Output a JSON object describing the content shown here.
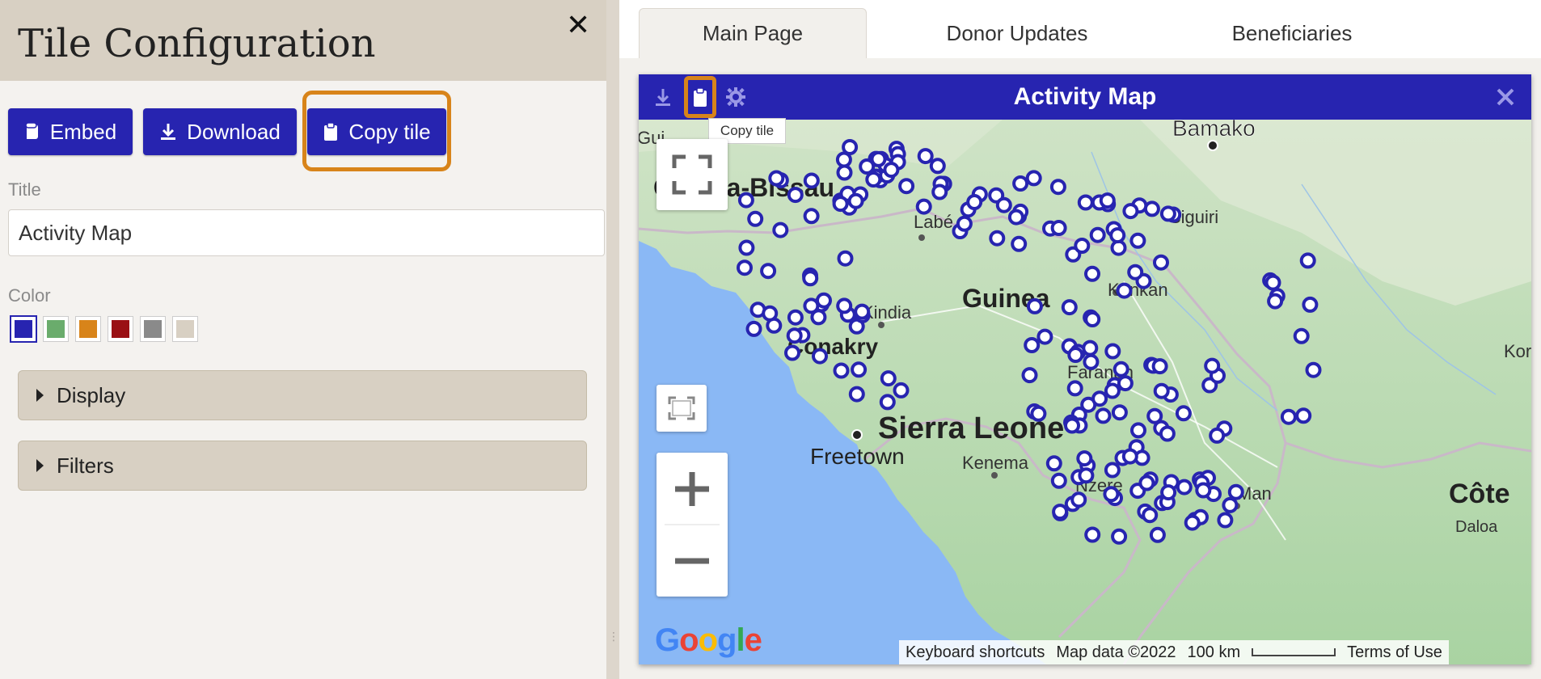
{
  "config_panel": {
    "title": "Tile Configuration",
    "close_glyph": "✕",
    "buttons": {
      "embed": "Embed",
      "download": "Download",
      "copy_tile": "Copy tile"
    },
    "title_field_label": "Title",
    "title_value": "Activity Map",
    "color_label": "Color",
    "colors": [
      "#2724b0",
      "#6aac6c",
      "#d8841a",
      "#9a1014",
      "#8a8a8a",
      "#d8d0c3"
    ],
    "selected_color": "#2724b0",
    "sections": {
      "display": "Display",
      "filters": "Filters"
    }
  },
  "tabs": [
    "Main Page",
    "Donor Updates",
    "Beneficiaries"
  ],
  "active_tab": "Main Page",
  "tile": {
    "title": "Activity Map",
    "header_icons": [
      "download-icon",
      "clipboard-icon",
      "gear-icon"
    ],
    "tooltip": "Copy tile"
  },
  "map": {
    "labels": {
      "bamako": "Bamako",
      "guinea_bissau": "Guinea-Bissau",
      "guinea": "Guinea",
      "kindia": "Kindia",
      "conakry": "Conakry",
      "sierra_leone": "Sierra Leone",
      "freetown": "Freetown",
      "kenema": "Kenema",
      "nzere": "Nzere",
      "man": "Man",
      "cote": "Côte",
      "kankan": "Kankan",
      "siguiri": "Siguiri",
      "labe": "Labé",
      "kor": "Kor",
      "gui": "Gui",
      "faranah": "Faranah",
      "daloa": "Daloa"
    },
    "attribution": {
      "shortcuts": "Keyboard shortcuts",
      "map_data": "Map data ©2022",
      "scale": "100 km",
      "terms": "Terms of Use"
    },
    "logo": "Google"
  }
}
